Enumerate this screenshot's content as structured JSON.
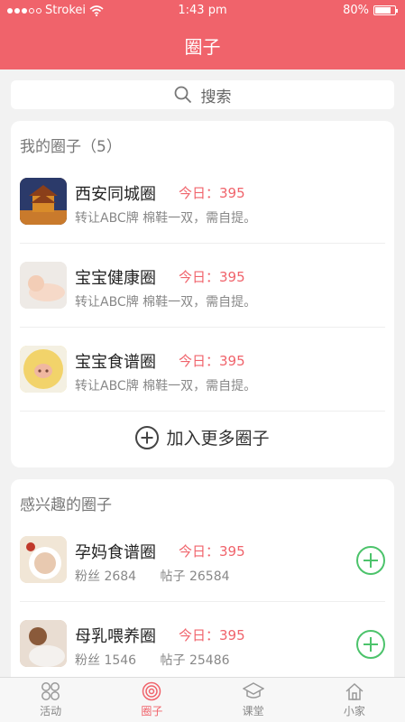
{
  "status_bar": {
    "carrier": "Strokei",
    "time": "1:43 pm",
    "battery": "80%"
  },
  "header": {
    "title": "圈子"
  },
  "search": {
    "label": "搜索"
  },
  "my_circles": {
    "title": "我的圈子（5）",
    "items": [
      {
        "name": "西安同城圈",
        "today": "今日：395",
        "desc": "转让ABC牌 棉鞋一双，需自提。",
        "thumb_color": "#a8662a"
      },
      {
        "name": "宝宝健康圈",
        "today": "今日：395",
        "desc": "转让ABC牌 棉鞋一双，需自提。",
        "thumb_color": "#e9e3de"
      },
      {
        "name": "宝宝食谱圈",
        "today": "今日：395",
        "desc": "转让ABC牌 棉鞋一双，需自提。",
        "thumb_color": "#f2d36a"
      }
    ],
    "join_label": "加入更多圈子"
  },
  "interest_circles": {
    "title": "感兴趣的圈子",
    "items": [
      {
        "name": "孕妈食谱圈",
        "today": "今日：395",
        "fans": "粉丝 2684",
        "posts": "帖子 26584",
        "thumb_color": "#e8d9c5"
      },
      {
        "name": "母乳喂养圈",
        "today": "今日：395",
        "fans": "粉丝 1546",
        "posts": "帖子 25486",
        "thumb_color": "#d9b79a"
      }
    ]
  },
  "tabbar": {
    "items": [
      {
        "label": "活动",
        "icon": "activity-grid-icon",
        "active": false
      },
      {
        "label": "圈子",
        "icon": "target-circle-icon",
        "active": true
      },
      {
        "label": "课堂",
        "icon": "graduation-cap-icon",
        "active": false
      },
      {
        "label": "小家",
        "icon": "home-icon",
        "active": false
      }
    ]
  },
  "colors": {
    "accent": "#f0636b",
    "add_green": "#4cc36b"
  }
}
